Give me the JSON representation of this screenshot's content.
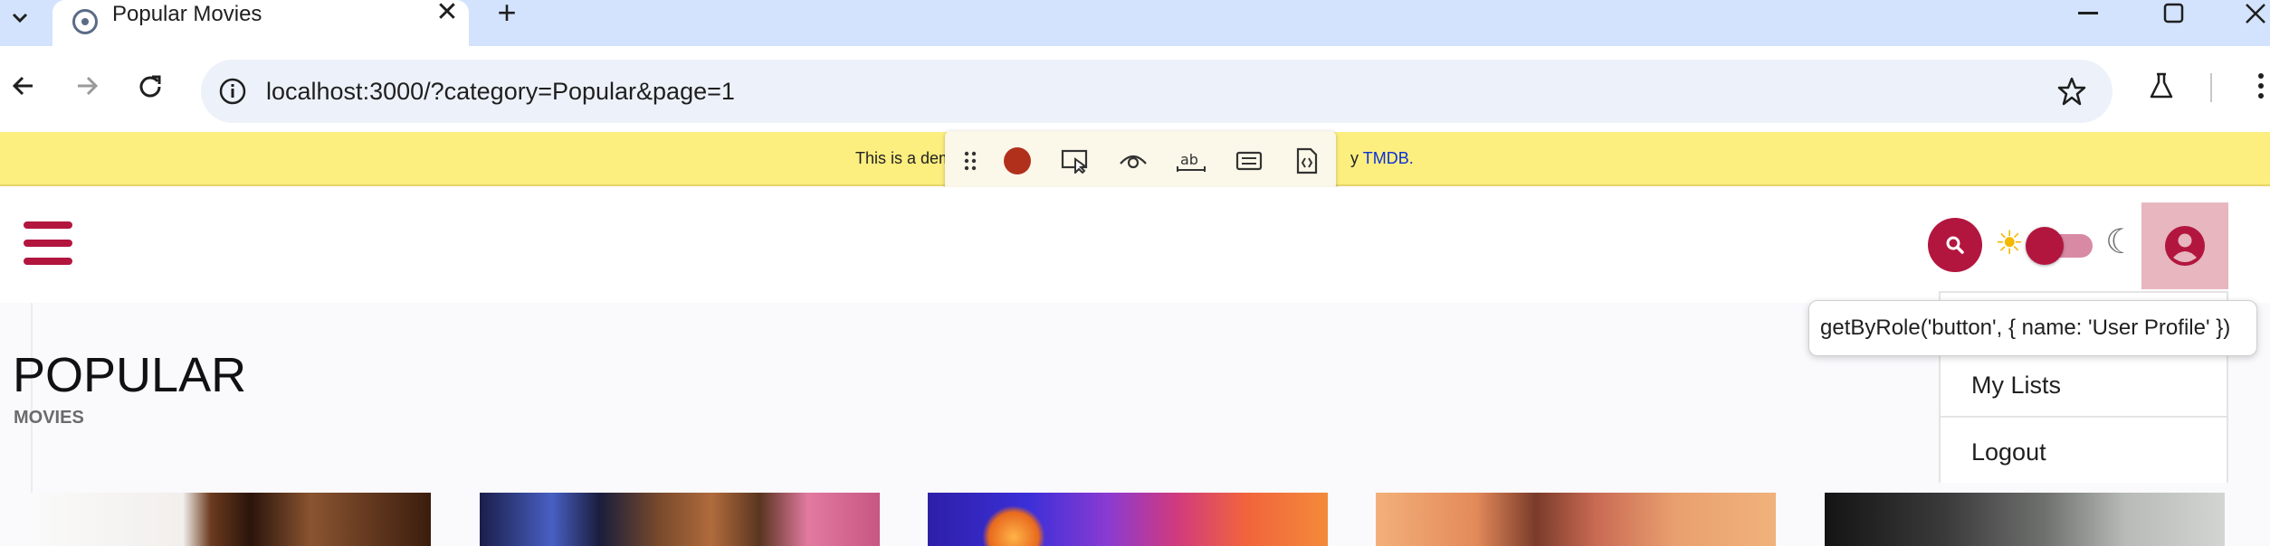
{
  "browser": {
    "tab": {
      "title": "Popular Movies",
      "close_symbol": "✕"
    },
    "new_tab_symbol": "+",
    "address_bar": {
      "url": "localhost:3000/?category=Popular&page=1"
    }
  },
  "banner": {
    "text_before": "This is a dem",
    "text_after": "y",
    "link_text": "TMDB."
  },
  "recorder": {
    "tools": [
      "drag-handle-icon",
      "record-icon",
      "pick-locator-icon",
      "assert-visibility-icon",
      "assert-text-icon",
      "assert-value-icon",
      "assert-snapshot-icon"
    ],
    "record_color": "#b1301c"
  },
  "header": {
    "accent_color": "#b2163e",
    "theme": {
      "sun_symbol": "☀",
      "moon_symbol": "☾"
    }
  },
  "page": {
    "title": "POPULAR",
    "subtitle": "MOVIES"
  },
  "profile_menu": {
    "items": [
      "My Lists",
      "Logout"
    ]
  },
  "locator_tooltip": {
    "text": "getByRole('button', { name: 'User Profile' })"
  },
  "posters": [
    "poster-1",
    "poster-2",
    "poster-3",
    "poster-4",
    "poster-5"
  ]
}
